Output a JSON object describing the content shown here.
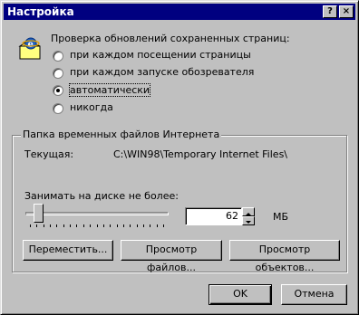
{
  "window": {
    "title": "Настройка"
  },
  "titlebar_buttons": {
    "help": "?",
    "close": "×"
  },
  "check": {
    "label": "Проверка обновлений сохраненных страниц:",
    "options": [
      {
        "label": "при каждом посещении страницы",
        "selected": false
      },
      {
        "label": "при каждом запуске обозревателя",
        "selected": false
      },
      {
        "label": "автоматически",
        "selected": true
      },
      {
        "label": "никогда",
        "selected": false
      }
    ]
  },
  "temp_folder": {
    "group_title": "Папка временных файлов Интернета",
    "current_label": "Текущая:",
    "current_path": "C:\\WIN98\\Temporary Internet Files\\",
    "disk_label": "Занимать на диске не более:",
    "disk_percent": 6,
    "mb_value": "62",
    "mb_unit": "МБ",
    "buttons": {
      "move": "Переместить...",
      "view_files": "Просмотр файлов...",
      "view_objects": "Просмотр объектов..."
    }
  },
  "footer": {
    "ok": "OK",
    "cancel": "Отмена"
  },
  "colors": {
    "titlebar": "#000080",
    "face": "#c0c0c0"
  }
}
